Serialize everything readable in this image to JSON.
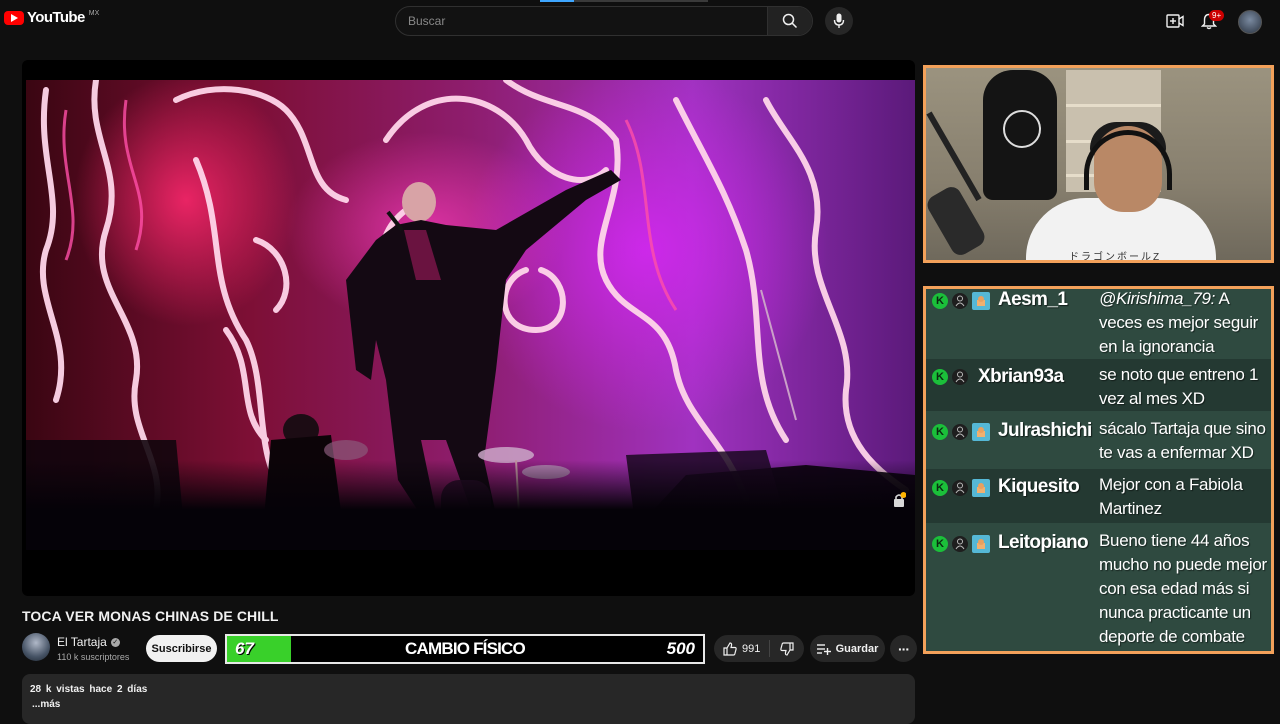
{
  "header": {
    "logo_text": "YouTube",
    "logo_country": "MX",
    "search_placeholder": "Buscar",
    "notification_badge": "9+",
    "watch_progress_fraction": 0.2
  },
  "video": {
    "title": "TOCA VER MONAS CHINAS DE CHILL",
    "channel_name": "El Tartaja",
    "channel_subs": "110 k suscriptores",
    "subscribe_label": "Suscribirse",
    "likes": "991",
    "save_label": "Guardar",
    "more_label": "···",
    "views": "28 k vistas",
    "date": "hace 2 días",
    "more_text": "...más"
  },
  "goal_overlay": {
    "current": "67",
    "label": "CAMBIO FÍSICO",
    "target": "500",
    "fill_fraction": 0.134,
    "fill_color": "#39d02a"
  },
  "webcam": {
    "shirt_text": "ドラゴンボールZ"
  },
  "chat": {
    "messages": [
      {
        "user": "Aesm_1",
        "mention": "@Kirishima_79:",
        "text": "A veces es mejor seguir en la ignorancia",
        "subscriber": true
      },
      {
        "user": "Xbrian93a",
        "mention": "",
        "text": "se noto que entreno 1 vez al mes XD",
        "subscriber": false
      },
      {
        "user": "Julrashichi",
        "mention": "",
        "text": "sácalo Tartaja que sino te vas a enfermar XD",
        "subscriber": true
      },
      {
        "user": "Kiquesito",
        "mention": "",
        "text": "Mejor con a Fabiola Martinez",
        "subscriber": true
      },
      {
        "user": "Leitopiano",
        "mention": "",
        "text": "Bueno tiene 44 años mucho no puede mejor con esa edad más si nunca practicante un deporte de combate",
        "subscriber": true
      }
    ]
  },
  "colors": {
    "accent_border": "#f3a15a",
    "chat_bg": "#2f4a40",
    "youtube_red": "#ff0000"
  }
}
